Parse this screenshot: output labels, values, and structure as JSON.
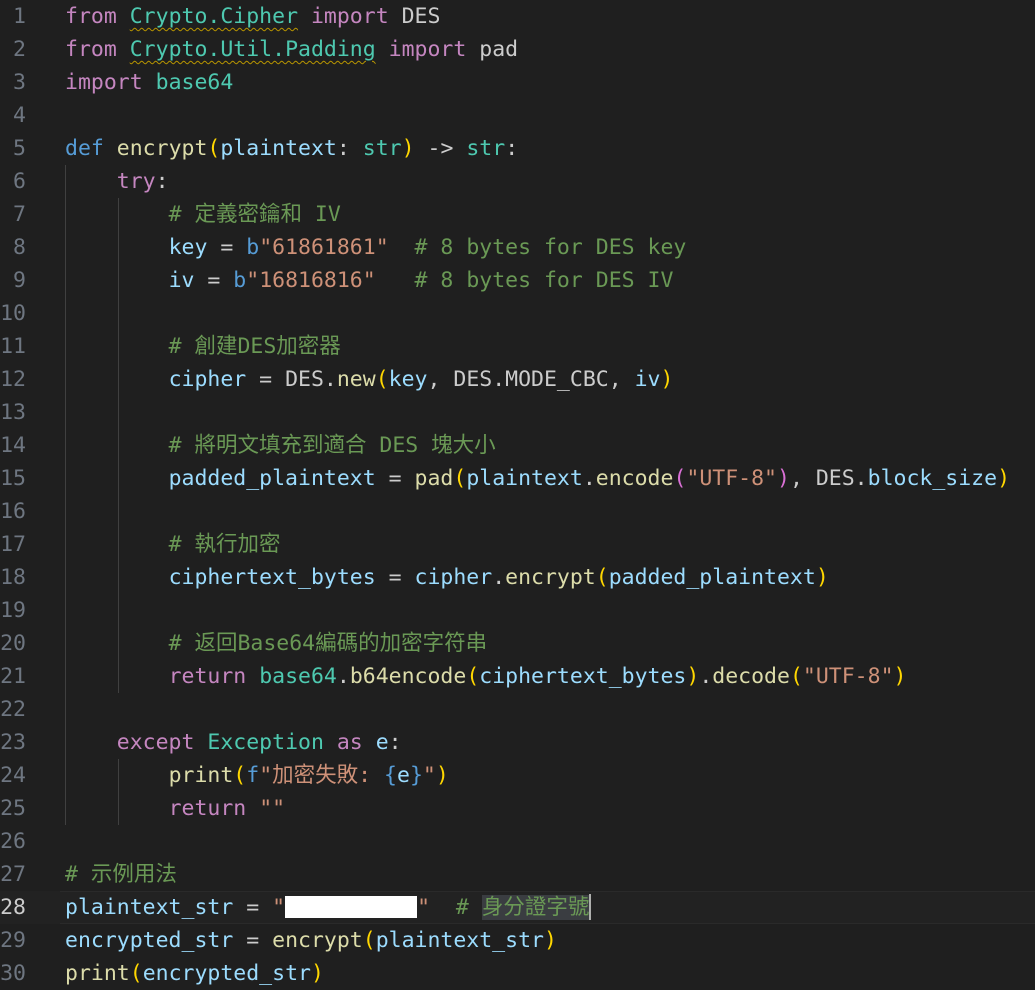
{
  "editor": {
    "active_line": 28,
    "lines": [
      {
        "n": "1",
        "indent": 0,
        "tokens": [
          [
            "from",
            "kw"
          ],
          [
            " ",
            "plain"
          ],
          [
            "Crypto.Cipher",
            "cls squig"
          ],
          [
            " ",
            "plain"
          ],
          [
            "import",
            "kw"
          ],
          [
            " DES",
            "plain"
          ]
        ]
      },
      {
        "n": "2",
        "indent": 0,
        "tokens": [
          [
            "from",
            "kw"
          ],
          [
            " ",
            "plain"
          ],
          [
            "Crypto.Util.Padding",
            "cls squig"
          ],
          [
            " ",
            "plain"
          ],
          [
            "import",
            "kw"
          ],
          [
            " pad",
            "plain"
          ]
        ]
      },
      {
        "n": "3",
        "indent": 0,
        "tokens": [
          [
            "import",
            "kw"
          ],
          [
            " ",
            "plain"
          ],
          [
            "base64",
            "cls"
          ]
        ]
      },
      {
        "n": "4",
        "indent": 0,
        "tokens": []
      },
      {
        "n": "5",
        "indent": 0,
        "tokens": [
          [
            "def",
            "kw2"
          ],
          [
            " ",
            "plain"
          ],
          [
            "encrypt",
            "fn"
          ],
          [
            "(",
            "b1"
          ],
          [
            "plaintext",
            "var"
          ],
          [
            ": ",
            "plain"
          ],
          [
            "str",
            "cls"
          ],
          [
            ")",
            "b1"
          ],
          [
            " ",
            "plain"
          ],
          [
            "->",
            "plain"
          ],
          [
            " ",
            "plain"
          ],
          [
            "str",
            "cls"
          ],
          [
            ":",
            "plain"
          ]
        ]
      },
      {
        "n": "6",
        "indent": 1,
        "tokens": [
          [
            "    ",
            "plain"
          ],
          [
            "try",
            "kw"
          ],
          [
            ":",
            "plain"
          ]
        ]
      },
      {
        "n": "7",
        "indent": 2,
        "tokens": [
          [
            "        ",
            "plain"
          ],
          [
            "# 定義密鑰和 IV",
            "cm"
          ]
        ]
      },
      {
        "n": "8",
        "indent": 2,
        "tokens": [
          [
            "        ",
            "plain"
          ],
          [
            "key",
            "var"
          ],
          [
            " = ",
            "plain"
          ],
          [
            "b",
            "kw2"
          ],
          [
            "\"61861861\"",
            "str"
          ],
          [
            "  ",
            "plain"
          ],
          [
            "# 8 bytes for DES key",
            "cm"
          ]
        ]
      },
      {
        "n": "9",
        "indent": 2,
        "tokens": [
          [
            "        ",
            "plain"
          ],
          [
            "iv",
            "var"
          ],
          [
            " = ",
            "plain"
          ],
          [
            "b",
            "kw2"
          ],
          [
            "\"16816816\"",
            "str"
          ],
          [
            "   ",
            "plain"
          ],
          [
            "# 8 bytes for DES IV",
            "cm"
          ]
        ]
      },
      {
        "n": "10",
        "indent": 2,
        "tokens": []
      },
      {
        "n": "11",
        "indent": 2,
        "tokens": [
          [
            "        ",
            "plain"
          ],
          [
            "# 創建DES加密器",
            "cm"
          ]
        ]
      },
      {
        "n": "12",
        "indent": 2,
        "tokens": [
          [
            "        ",
            "plain"
          ],
          [
            "cipher",
            "var"
          ],
          [
            " = DES.",
            "plain"
          ],
          [
            "new",
            "fn"
          ],
          [
            "(",
            "b1"
          ],
          [
            "key",
            "var"
          ],
          [
            ", DES.MODE_CBC, ",
            "plain"
          ],
          [
            "iv",
            "var"
          ],
          [
            ")",
            "b1"
          ]
        ]
      },
      {
        "n": "13",
        "indent": 2,
        "tokens": []
      },
      {
        "n": "14",
        "indent": 2,
        "tokens": [
          [
            "        ",
            "plain"
          ],
          [
            "# 將明文填充到適合 DES 塊大小",
            "cm"
          ]
        ]
      },
      {
        "n": "15",
        "indent": 2,
        "tokens": [
          [
            "        ",
            "plain"
          ],
          [
            "padded_plaintext",
            "var"
          ],
          [
            " = ",
            "plain"
          ],
          [
            "pad",
            "fn"
          ],
          [
            "(",
            "b1"
          ],
          [
            "plaintext",
            "var"
          ],
          [
            ".",
            "plain"
          ],
          [
            "encode",
            "fn"
          ],
          [
            "(",
            "b2"
          ],
          [
            "\"UTF-8\"",
            "str"
          ],
          [
            ")",
            "b2"
          ],
          [
            ", DES.",
            "plain"
          ],
          [
            "block_size",
            "var"
          ],
          [
            ")",
            "b1"
          ]
        ]
      },
      {
        "n": "16",
        "indent": 2,
        "tokens": []
      },
      {
        "n": "17",
        "indent": 2,
        "tokens": [
          [
            "        ",
            "plain"
          ],
          [
            "# 執行加密",
            "cm"
          ]
        ]
      },
      {
        "n": "18",
        "indent": 2,
        "tokens": [
          [
            "        ",
            "plain"
          ],
          [
            "ciphertext_bytes",
            "var"
          ],
          [
            " = ",
            "plain"
          ],
          [
            "cipher",
            "var"
          ],
          [
            ".",
            "plain"
          ],
          [
            "encrypt",
            "fn"
          ],
          [
            "(",
            "b1"
          ],
          [
            "padded_plaintext",
            "var"
          ],
          [
            ")",
            "b1"
          ]
        ]
      },
      {
        "n": "19",
        "indent": 2,
        "tokens": []
      },
      {
        "n": "20",
        "indent": 2,
        "tokens": [
          [
            "        ",
            "plain"
          ],
          [
            "# 返回Base64編碼的加密字符串",
            "cm"
          ]
        ]
      },
      {
        "n": "21",
        "indent": 2,
        "tokens": [
          [
            "        ",
            "plain"
          ],
          [
            "return",
            "kw"
          ],
          [
            " ",
            "plain"
          ],
          [
            "base64",
            "cls"
          ],
          [
            ".",
            "plain"
          ],
          [
            "b64encode",
            "fn"
          ],
          [
            "(",
            "b1"
          ],
          [
            "ciphertext_bytes",
            "var"
          ],
          [
            ")",
            "b1"
          ],
          [
            ".",
            "plain"
          ],
          [
            "decode",
            "fn"
          ],
          [
            "(",
            "b1"
          ],
          [
            "\"UTF-8\"",
            "str"
          ],
          [
            ")",
            "b1"
          ]
        ]
      },
      {
        "n": "22",
        "indent": 1,
        "tokens": []
      },
      {
        "n": "23",
        "indent": 1,
        "tokens": [
          [
            "    ",
            "plain"
          ],
          [
            "except",
            "kw"
          ],
          [
            " ",
            "plain"
          ],
          [
            "Exception",
            "cls"
          ],
          [
            " ",
            "plain"
          ],
          [
            "as",
            "kw"
          ],
          [
            " ",
            "plain"
          ],
          [
            "e",
            "var"
          ],
          [
            ":",
            "plain"
          ]
        ]
      },
      {
        "n": "24",
        "indent": 2,
        "tokens": [
          [
            "        ",
            "plain"
          ],
          [
            "print",
            "fn"
          ],
          [
            "(",
            "b1"
          ],
          [
            "f",
            "kw2"
          ],
          [
            "\"加密失敗: ",
            "str"
          ],
          [
            "{",
            "kw2"
          ],
          [
            "e",
            "var"
          ],
          [
            "}",
            "kw2"
          ],
          [
            "\"",
            "str"
          ],
          [
            ")",
            "b1"
          ]
        ]
      },
      {
        "n": "25",
        "indent": 2,
        "tokens": [
          [
            "        ",
            "plain"
          ],
          [
            "return",
            "kw"
          ],
          [
            " ",
            "plain"
          ],
          [
            "\"\"",
            "str"
          ]
        ]
      },
      {
        "n": "26",
        "indent": 0,
        "tokens": []
      },
      {
        "n": "27",
        "indent": 0,
        "tokens": [
          [
            "# 示例用法",
            "cm"
          ]
        ]
      },
      {
        "n": "28",
        "indent": 0,
        "tokens": [
          [
            "plaintext_str",
            "var"
          ],
          [
            " = ",
            "plain"
          ],
          [
            "\"",
            "str"
          ],
          [
            "",
            "redact"
          ],
          [
            "\"",
            "str"
          ],
          [
            "  ",
            "plain"
          ],
          [
            "# ",
            "cm"
          ],
          [
            "身分證字號",
            "cm hl"
          ],
          [
            "",
            "cursor"
          ]
        ]
      },
      {
        "n": "29",
        "indent": 0,
        "tokens": [
          [
            "encrypted_str",
            "var"
          ],
          [
            " = ",
            "plain"
          ],
          [
            "encrypt",
            "fn"
          ],
          [
            "(",
            "b1"
          ],
          [
            "plaintext_str",
            "var"
          ],
          [
            ")",
            "b1"
          ]
        ]
      },
      {
        "n": "30",
        "indent": 0,
        "tokens": [
          [
            "print",
            "fn"
          ],
          [
            "(",
            "b1"
          ],
          [
            "encrypted_str",
            "var"
          ],
          [
            ")",
            "b1"
          ]
        ]
      }
    ]
  }
}
